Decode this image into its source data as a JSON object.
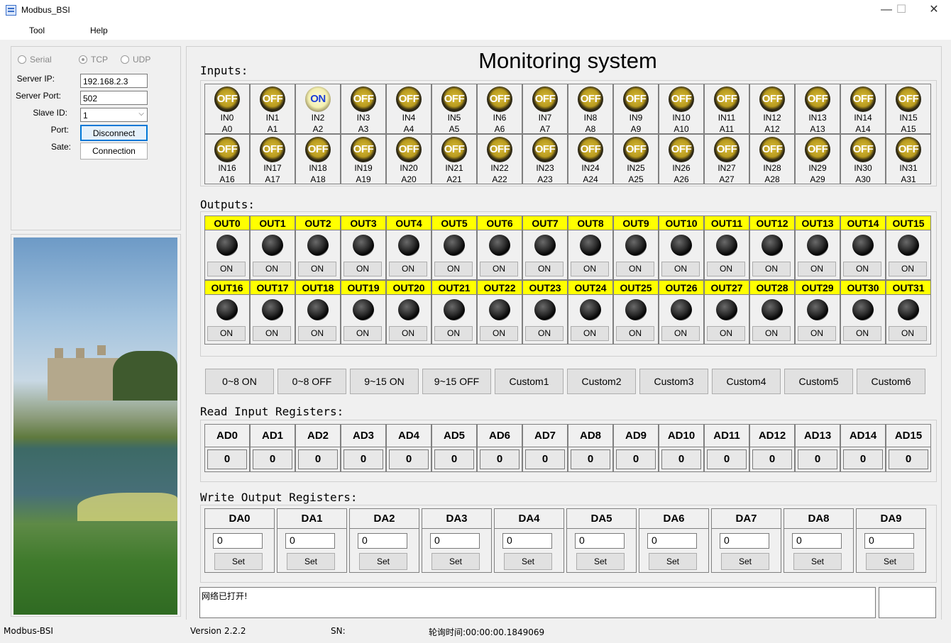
{
  "window": {
    "title": "Modbus_BSI",
    "minimize": "—",
    "maximize": "☐",
    "close": "✕"
  },
  "menu": [
    {
      "label": "Tool"
    },
    {
      "label": "Help"
    }
  ],
  "connection": {
    "modes": [
      {
        "label": "Serial"
      },
      {
        "label": "TCP"
      },
      {
        "label": "UDP"
      }
    ],
    "server_ip_label": "Server IP:",
    "server_ip": "192.168.2.3",
    "server_port_label": "Server Port:",
    "server_port": "502",
    "slave_id_label": "Slave ID:",
    "slave_id": "1",
    "port_label": "Port:",
    "port_button": "Disconnect",
    "sate_label": "Sate:",
    "sate_button": "Connection"
  },
  "main_title": "Monitoring system",
  "inputs_label": "Inputs:",
  "inputs": [
    {
      "name": "IN0",
      "addr": "A0",
      "state": "OFF"
    },
    {
      "name": "IN1",
      "addr": "A1",
      "state": "OFF"
    },
    {
      "name": "IN2",
      "addr": "A2",
      "state": "ON"
    },
    {
      "name": "IN3",
      "addr": "A3",
      "state": "OFF"
    },
    {
      "name": "IN4",
      "addr": "A4",
      "state": "OFF"
    },
    {
      "name": "IN5",
      "addr": "A5",
      "state": "OFF"
    },
    {
      "name": "IN6",
      "addr": "A6",
      "state": "OFF"
    },
    {
      "name": "IN7",
      "addr": "A7",
      "state": "OFF"
    },
    {
      "name": "IN8",
      "addr": "A8",
      "state": "OFF"
    },
    {
      "name": "IN9",
      "addr": "A9",
      "state": "OFF"
    },
    {
      "name": "IN10",
      "addr": "A10",
      "state": "OFF"
    },
    {
      "name": "IN11",
      "addr": "A11",
      "state": "OFF"
    },
    {
      "name": "IN12",
      "addr": "A12",
      "state": "OFF"
    },
    {
      "name": "IN13",
      "addr": "A13",
      "state": "OFF"
    },
    {
      "name": "IN14",
      "addr": "A14",
      "state": "OFF"
    },
    {
      "name": "IN15",
      "addr": "A15",
      "state": "OFF"
    },
    {
      "name": "IN16",
      "addr": "A16",
      "state": "OFF"
    },
    {
      "name": "IN17",
      "addr": "A17",
      "state": "OFF"
    },
    {
      "name": "IN18",
      "addr": "A18",
      "state": "OFF"
    },
    {
      "name": "IN19",
      "addr": "A19",
      "state": "OFF"
    },
    {
      "name": "IN20",
      "addr": "A20",
      "state": "OFF"
    },
    {
      "name": "IN21",
      "addr": "A21",
      "state": "OFF"
    },
    {
      "name": "IN22",
      "addr": "A22",
      "state": "OFF"
    },
    {
      "name": "IN23",
      "addr": "A23",
      "state": "OFF"
    },
    {
      "name": "IN24",
      "addr": "A24",
      "state": "OFF"
    },
    {
      "name": "IN25",
      "addr": "A25",
      "state": "OFF"
    },
    {
      "name": "IN26",
      "addr": "A26",
      "state": "OFF"
    },
    {
      "name": "IN27",
      "addr": "A27",
      "state": "OFF"
    },
    {
      "name": "IN28",
      "addr": "A28",
      "state": "OFF"
    },
    {
      "name": "IN29",
      "addr": "A29",
      "state": "OFF"
    },
    {
      "name": "IN30",
      "addr": "A30",
      "state": "OFF"
    },
    {
      "name": "IN31",
      "addr": "A31",
      "state": "OFF"
    }
  ],
  "outputs_label": "Outputs:",
  "outputs": [
    {
      "name": "OUT0",
      "button": "ON"
    },
    {
      "name": "OUT1",
      "button": "ON"
    },
    {
      "name": "OUT2",
      "button": "ON"
    },
    {
      "name": "OUT3",
      "button": "ON"
    },
    {
      "name": "OUT4",
      "button": "ON"
    },
    {
      "name": "OUT5",
      "button": "ON"
    },
    {
      "name": "OUT6",
      "button": "ON"
    },
    {
      "name": "OUT7",
      "button": "ON"
    },
    {
      "name": "OUT8",
      "button": "ON"
    },
    {
      "name": "OUT9",
      "button": "ON"
    },
    {
      "name": "OUT10",
      "button": "ON"
    },
    {
      "name": "OUT11",
      "button": "ON"
    },
    {
      "name": "OUT12",
      "button": "ON"
    },
    {
      "name": "OUT13",
      "button": "ON"
    },
    {
      "name": "OUT14",
      "button": "ON"
    },
    {
      "name": "OUT15",
      "button": "ON"
    },
    {
      "name": "OUT16",
      "button": "ON"
    },
    {
      "name": "OUT17",
      "button": "ON"
    },
    {
      "name": "OUT18",
      "button": "ON"
    },
    {
      "name": "OUT19",
      "button": "ON"
    },
    {
      "name": "OUT20",
      "button": "ON"
    },
    {
      "name": "OUT21",
      "button": "ON"
    },
    {
      "name": "OUT22",
      "button": "ON"
    },
    {
      "name": "OUT23",
      "button": "ON"
    },
    {
      "name": "OUT24",
      "button": "ON"
    },
    {
      "name": "OUT25",
      "button": "ON"
    },
    {
      "name": "OUT26",
      "button": "ON"
    },
    {
      "name": "OUT27",
      "button": "ON"
    },
    {
      "name": "OUT28",
      "button": "ON"
    },
    {
      "name": "OUT29",
      "button": "ON"
    },
    {
      "name": "OUT30",
      "button": "ON"
    },
    {
      "name": "OUT31",
      "button": "ON"
    }
  ],
  "quick_buttons": [
    {
      "label": "0~8 ON"
    },
    {
      "label": "0~8 OFF"
    },
    {
      "label": "9~15 ON"
    },
    {
      "label": "9~15 OFF"
    },
    {
      "label": "Custom1"
    },
    {
      "label": "Custom2"
    },
    {
      "label": "Custom3"
    },
    {
      "label": "Custom4"
    },
    {
      "label": "Custom5"
    },
    {
      "label": "Custom6"
    }
  ],
  "read_label": "Read Input Registers:",
  "read_registers": [
    {
      "name": "AD0",
      "value": "0"
    },
    {
      "name": "AD1",
      "value": "0"
    },
    {
      "name": "AD2",
      "value": "0"
    },
    {
      "name": "AD3",
      "value": "0"
    },
    {
      "name": "AD4",
      "value": "0"
    },
    {
      "name": "AD5",
      "value": "0"
    },
    {
      "name": "AD6",
      "value": "0"
    },
    {
      "name": "AD7",
      "value": "0"
    },
    {
      "name": "AD8",
      "value": "0"
    },
    {
      "name": "AD9",
      "value": "0"
    },
    {
      "name": "AD10",
      "value": "0"
    },
    {
      "name": "AD11",
      "value": "0"
    },
    {
      "name": "AD12",
      "value": "0"
    },
    {
      "name": "AD13",
      "value": "0"
    },
    {
      "name": "AD14",
      "value": "0"
    },
    {
      "name": "AD15",
      "value": "0"
    }
  ],
  "write_label": "Write Output Registers:",
  "write_registers": [
    {
      "name": "DA0",
      "value": "0",
      "button": "Set"
    },
    {
      "name": "DA1",
      "value": "0",
      "button": "Set"
    },
    {
      "name": "DA2",
      "value": "0",
      "button": "Set"
    },
    {
      "name": "DA3",
      "value": "0",
      "button": "Set"
    },
    {
      "name": "DA4",
      "value": "0",
      "button": "Set"
    },
    {
      "name": "DA5",
      "value": "0",
      "button": "Set"
    },
    {
      "name": "DA6",
      "value": "0",
      "button": "Set"
    },
    {
      "name": "DA7",
      "value": "0",
      "button": "Set"
    },
    {
      "name": "DA8",
      "value": "0",
      "button": "Set"
    },
    {
      "name": "DA9",
      "value": "0",
      "button": "Set"
    }
  ],
  "log_text": "网络已打开!",
  "status": {
    "app": "Modbus-BSI",
    "version": "Version 2.2.2",
    "sn": "SN:",
    "poll_time": "轮询时间:00:00:00.1849069"
  }
}
